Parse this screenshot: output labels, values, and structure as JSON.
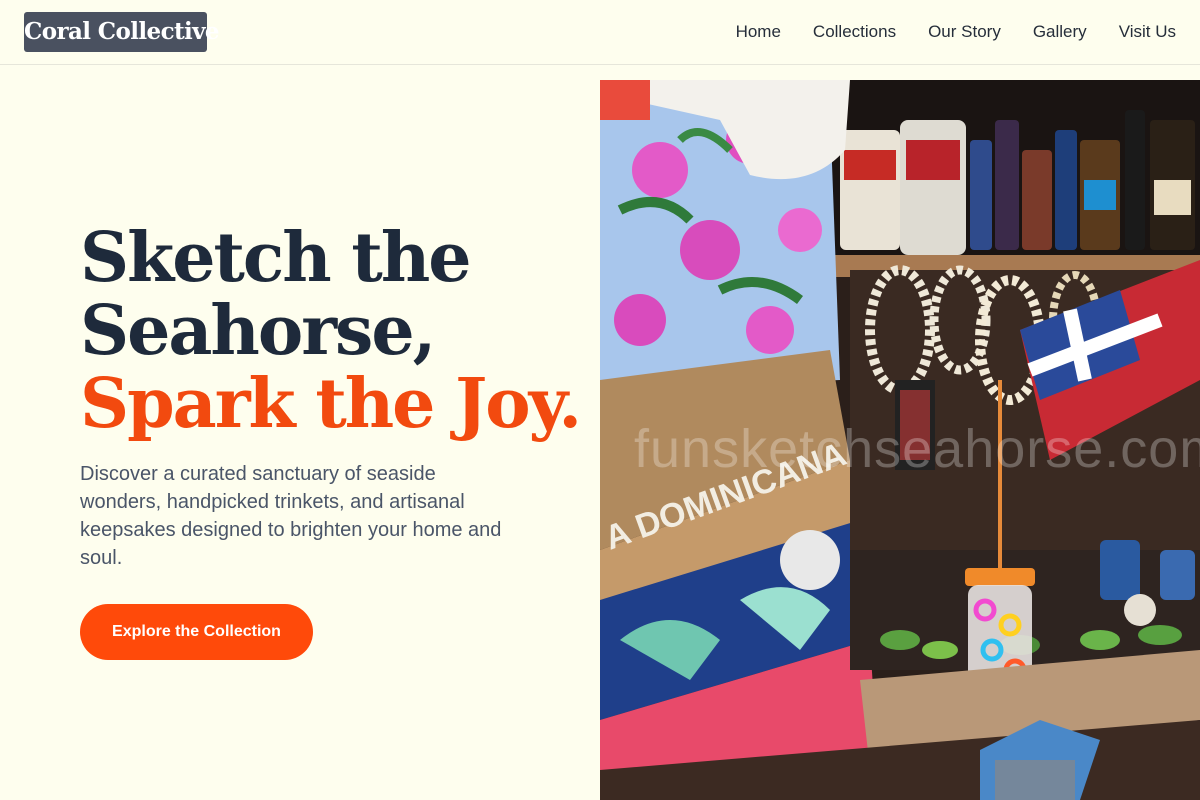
{
  "brand": {
    "name": "Coral Collective"
  },
  "nav": {
    "items": [
      {
        "label": "Home"
      },
      {
        "label": "Collections"
      },
      {
        "label": "Our Story"
      },
      {
        "label": "Gallery"
      },
      {
        "label": "Visit Us"
      }
    ]
  },
  "hero": {
    "title_line1": "Sketch the",
    "title_line2": "Seahorse,",
    "title_line3": "Spark the Joy.",
    "subtitle": "Discover a curated sanctuary of seaside wonders, handpicked trinkets, and artisanal keepsakes designed to brighten your home and soul.",
    "cta_label": "Explore the Collection"
  },
  "photo": {
    "watermark": "funsketchseahorse.com",
    "bag_text": "A DOMINICANA"
  },
  "colors": {
    "background": "#fefeee",
    "accent": "#ff4a0a",
    "heading": "#1e2a3b",
    "logo_bg": "#4a5160"
  }
}
